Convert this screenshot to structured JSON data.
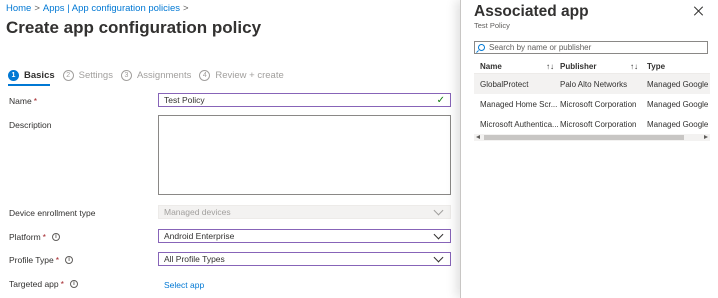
{
  "breadcrumb": {
    "items": [
      "Home",
      "Apps | App configuration policies"
    ],
    "sep": ">"
  },
  "page_title": "Create app configuration policy",
  "more_label": "···",
  "wizard": {
    "steps": [
      {
        "num": "1",
        "label": "Basics"
      },
      {
        "num": "2",
        "label": "Settings"
      },
      {
        "num": "3",
        "label": "Assignments"
      },
      {
        "num": "4",
        "label": "Review + create"
      }
    ]
  },
  "form": {
    "name": {
      "label": "Name",
      "required": "*",
      "value": "Test Policy"
    },
    "description": {
      "label": "Description",
      "value": ""
    },
    "device_enrollment_type": {
      "label": "Device enrollment type",
      "value": "Managed devices"
    },
    "platform": {
      "label": "Platform",
      "required": "*",
      "value": "Android Enterprise"
    },
    "profile_type": {
      "label": "Profile Type",
      "required": "*",
      "value": "All Profile Types"
    },
    "targeted_app": {
      "label": "Targeted app",
      "required": "*",
      "link": "Select app"
    }
  },
  "panel": {
    "title": "Associated app",
    "subtitle": "Test Policy",
    "search_placeholder": "Search by name or publisher",
    "columns": {
      "name": "Name",
      "publisher": "Publisher",
      "type": "Type",
      "sort_glyph": "↑↓"
    },
    "rows": [
      {
        "name": "GlobalProtect",
        "publisher": "Palo Alto Networks",
        "type": "Managed Google P"
      },
      {
        "name": "Managed Home Scr...",
        "publisher": "Microsoft Corporation",
        "type": "Managed Google P"
      },
      {
        "name": "Microsoft Authentica...",
        "publisher": "Microsoft Corporation",
        "type": "Managed Google P"
      }
    ]
  },
  "colors": {
    "accent": "#0078d4",
    "required": "#a4262c",
    "valid": "#107c10",
    "focus_border": "#8764b8"
  }
}
